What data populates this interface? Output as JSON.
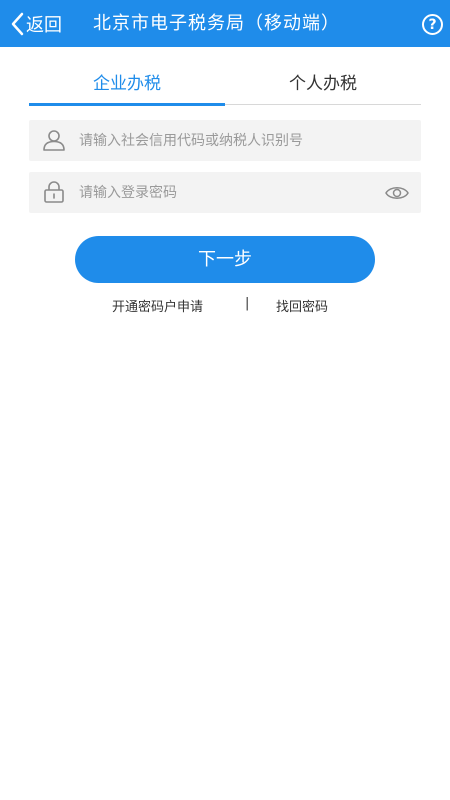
{
  "header": {
    "back_label": "返回",
    "title": "北京市电子税务局（移动端）",
    "help_icon": "?",
    "color": "#1f8cea"
  },
  "tabs": [
    {
      "label": "企业办税",
      "active": true
    },
    {
      "label": "个人办税",
      "active": false
    }
  ],
  "form": {
    "id_placeholder": "请输入社会信用代码或纳税人识别号",
    "id_value": "",
    "password_placeholder": "请输入登录密码",
    "password_value": "",
    "id_icon": "user-icon",
    "password_icon": "lock-icon",
    "toggle_icon": "eye-icon"
  },
  "next_button": "下一步",
  "links": {
    "open_account": "开通密码户申请",
    "separator": "|",
    "find_password": "找回密码"
  }
}
